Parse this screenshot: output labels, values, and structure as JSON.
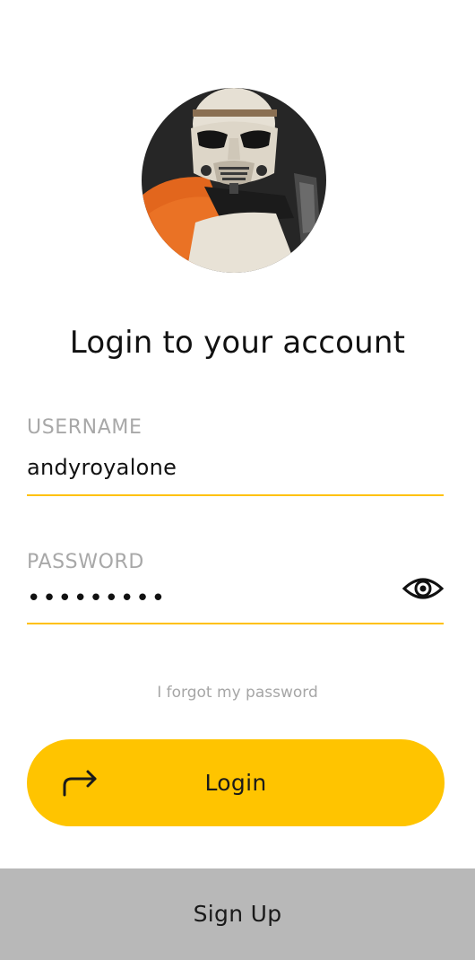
{
  "avatar": {
    "icon": "stormtrooper-avatar",
    "accent_color": "#e86a1f"
  },
  "title": "Login to your account",
  "username": {
    "label": "USERNAME",
    "value": "andyroyalone"
  },
  "password": {
    "label": "PASSWORD",
    "masked_value": "•••••••••",
    "toggle_icon": "eye-icon"
  },
  "forgot_link": "I forgot my password",
  "login_button": {
    "label": "Login",
    "icon": "login-arrow-icon",
    "color": "#ffc400"
  },
  "signup": {
    "label": "Sign Up",
    "color": "#b8b8b8"
  },
  "colors": {
    "accent": "#ffc107",
    "label_gray": "#a8a8a8",
    "text": "#111111"
  }
}
